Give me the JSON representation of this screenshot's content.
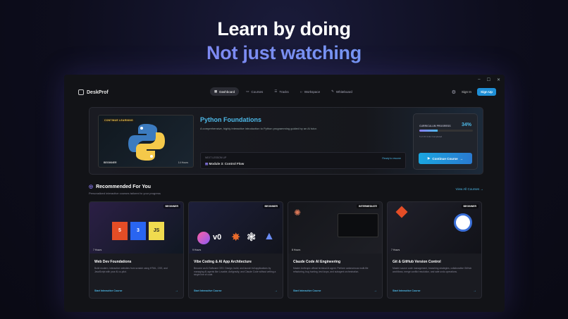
{
  "hero": {
    "title": "Learn by doing",
    "subtitle": "Not just watching"
  },
  "window": {
    "controls": [
      "–",
      "☐",
      "✕"
    ]
  },
  "nav": {
    "brand": "DeskProf",
    "tabs": [
      {
        "label": "Dashboard",
        "icon": "grid-icon"
      },
      {
        "label": "Courses",
        "icon": "book-icon"
      },
      {
        "label": "Tracks",
        "icon": "tracks-icon"
      },
      {
        "label": "Workspace",
        "icon": "code-icon"
      },
      {
        "label": "Whiteboard",
        "icon": "pen-icon"
      }
    ],
    "signin": "Sign In",
    "signup": "Sign Up"
  },
  "continue": {
    "badge": "CONTINUE LEARNING",
    "level": "BEGINNER",
    "hours": "14 Hours",
    "title": "Python Foundations",
    "desc": "A comprehensive, highly interactive introduction to Python programming guided by an AI tutor.",
    "next_label": "NEXT LESSON UP",
    "next_lesson": "Module 3: Control Flow",
    "ready": "Ready to resume"
  },
  "progress": {
    "label": "CURRICULUM PROGRESS",
    "percent": "34%",
    "fraction": 0.34,
    "sub": "5 of 15 Units Completed",
    "button": "Continue Course"
  },
  "recommended": {
    "title": "Recommended For You",
    "subtitle": "Personalized interactive courses tailored to your progress",
    "view_all": "View All Courses"
  },
  "cards": [
    {
      "title": "Web Dev Foundations",
      "level": "BEGINNER",
      "hours": "7 Hours",
      "desc": "Build modern, interactive websites from scratch using HTML, CSS, and JavaScript with your AI co-pilot.",
      "cta": "Start Interactive Course"
    },
    {
      "title": "Vibe Coding & AI App Architecture",
      "level": "BEGINNER",
      "hours": "9 Hours",
      "desc": "Become an AI Software CEO. Design, build, and launch full applications by managing AI agents like Lovable, Antigravity, and Claude Code without writing a single line of code.",
      "cta": "Start Interactive Course"
    },
    {
      "title": "Claude Code AI Engineering",
      "level": "INTERMEDIATE",
      "hours": "8 Hours",
      "desc": "Master Anthropic official terminal AI agent. Perform autonomous multi-file refactoring, bug hunting, test loops, and subagent orchestration.",
      "cta": "Start Interactive Course"
    },
    {
      "title": "Git & GitHub Version Control",
      "level": "BEGINNER",
      "hours": "7 Hours",
      "desc": "Master source code management, branching strategies, collaborative GitHub workflows, merge conflict resolution, and safe undo operations.",
      "cta": "Start Interactive Course"
    }
  ]
}
